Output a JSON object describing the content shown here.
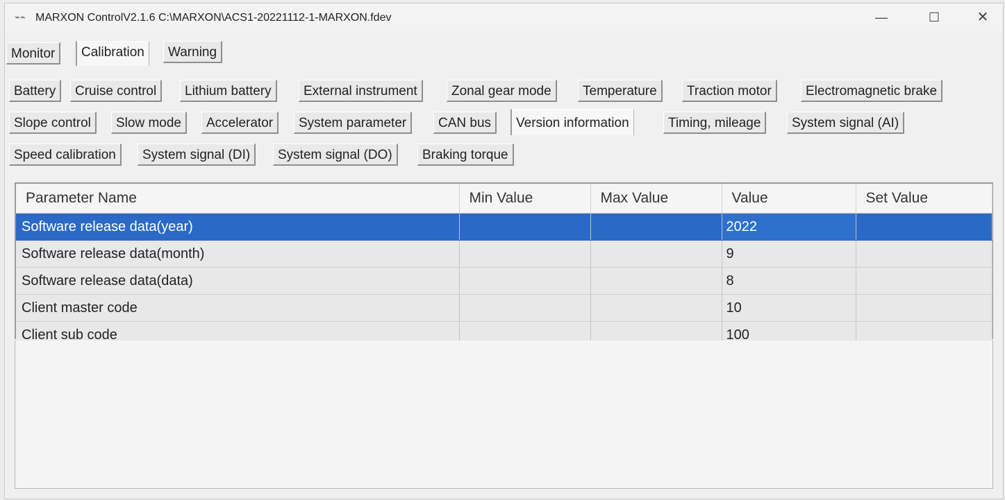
{
  "window": {
    "title": "MARXON ControlV2.1.6 C:\\MARXON\\ACS1-20221112-1-MARXON.fdev",
    "app_icon": "app-icon",
    "min_label": "—",
    "max_label": "☐",
    "close_label": "✕"
  },
  "main_tabs": [
    {
      "label": "Monitor"
    },
    {
      "label": "Calibration",
      "active": true
    },
    {
      "label": "Warning"
    }
  ],
  "sub_tabs_row1": [
    {
      "label": "Battery"
    },
    {
      "label": "Cruise control"
    },
    {
      "label": "Lithium battery"
    },
    {
      "label": "External instrument"
    },
    {
      "label": "Zonal gear mode"
    },
    {
      "label": "Temperature"
    },
    {
      "label": "Traction motor"
    },
    {
      "label": "Electromagnetic brake"
    }
  ],
  "sub_tabs_row2": [
    {
      "label": "Slope control"
    },
    {
      "label": "Slow mode"
    },
    {
      "label": "Accelerator"
    },
    {
      "label": "System parameter"
    },
    {
      "label": "CAN bus"
    },
    {
      "label": "Version information",
      "active": true
    },
    {
      "label": "Timing, mileage"
    },
    {
      "label": "System signal (AI)"
    }
  ],
  "sub_tabs_row3": [
    {
      "label": "Speed calibration"
    },
    {
      "label": "System signal (DI)"
    },
    {
      "label": "System signal (DO)"
    },
    {
      "label": "Braking torque"
    }
  ],
  "table": {
    "columns": [
      "Parameter Name",
      "Min Value",
      "Max Value",
      "Value",
      "Set Value"
    ],
    "rows": [
      {
        "name": "Software release data(year)",
        "min": "",
        "max": "",
        "value": "2022",
        "set": "",
        "selected": true
      },
      {
        "name": "Software release data(month)",
        "min": "",
        "max": "",
        "value": "9",
        "set": ""
      },
      {
        "name": "Software release data(data)",
        "min": "",
        "max": "",
        "value": "8",
        "set": ""
      },
      {
        "name": "Client master code",
        "min": "",
        "max": "",
        "value": "10",
        "set": ""
      },
      {
        "name": "Client sub code",
        "min": "",
        "max": "",
        "value": "100",
        "set": ""
      }
    ]
  },
  "colors": {
    "selection": "#2a6ac6",
    "window_bg": "#f0f0f0"
  }
}
